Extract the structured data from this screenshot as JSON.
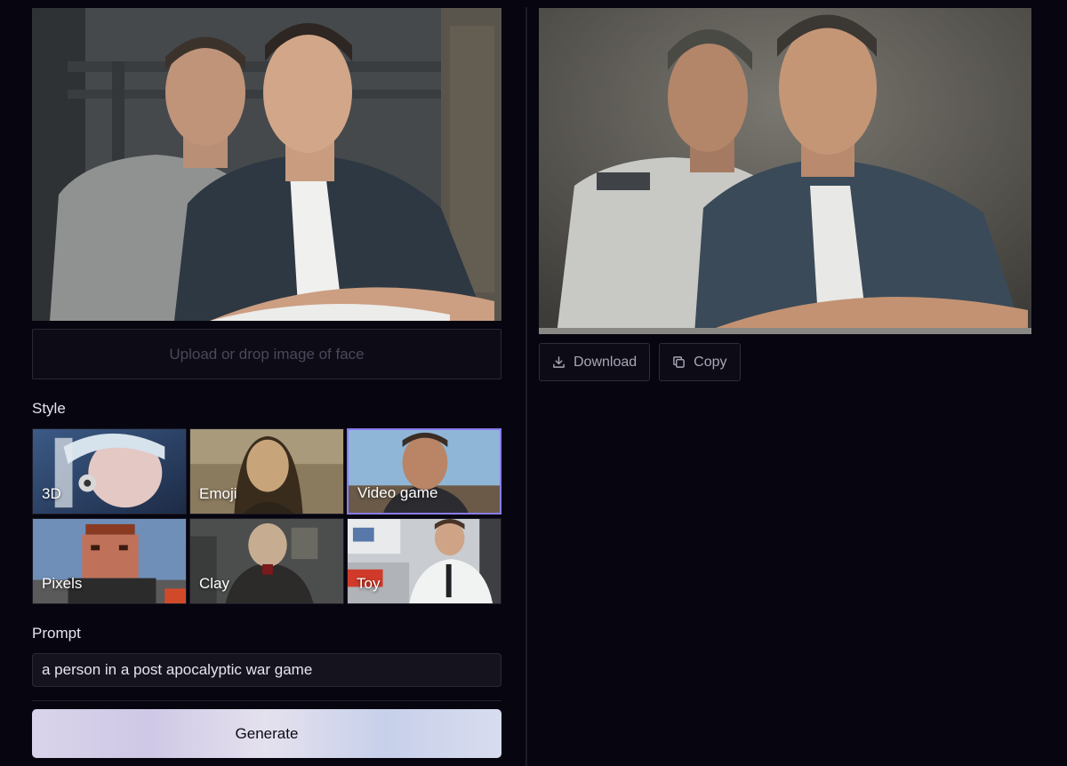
{
  "input": {
    "upload_placeholder": "Upload or drop image of face"
  },
  "style_section": {
    "label": "Style",
    "selected": "Video game",
    "options": [
      {
        "label": "3D",
        "icon": "style-3d-thumbnail"
      },
      {
        "label": "Emoji",
        "icon": "style-emoji-thumbnail"
      },
      {
        "label": "Video game",
        "icon": "style-video-game-thumbnail"
      },
      {
        "label": "Pixels",
        "icon": "style-pixels-thumbnail"
      },
      {
        "label": "Clay",
        "icon": "style-clay-thumbnail"
      },
      {
        "label": "Toy",
        "icon": "style-toy-thumbnail"
      }
    ]
  },
  "prompt_section": {
    "label": "Prompt",
    "value": "a person in a post apocalyptic war game"
  },
  "generate_label": "Generate",
  "output": {
    "download_label": "Download",
    "download_icon": "download-icon",
    "copy_label": "Copy",
    "copy_icon": "copy-icon"
  },
  "colors": {
    "background": "#07050f",
    "selected_border": "#8a7cf0",
    "input_bg": "#15131e"
  }
}
